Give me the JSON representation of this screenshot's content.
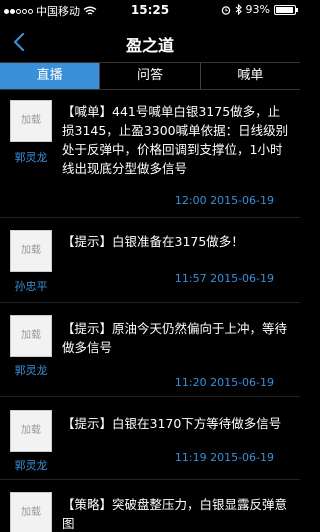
{
  "status_bar": {
    "carrier": "中国移动",
    "time": "15:25",
    "battery_percent": "93%",
    "battery_level": 0.93
  },
  "nav": {
    "title": "盈之道"
  },
  "tabs": [
    {
      "label": "直播",
      "active": true
    },
    {
      "label": "问答",
      "active": false
    },
    {
      "label": "喊单",
      "active": false
    }
  ],
  "messages": [
    {
      "avatar_label": "加载",
      "author": "郭灵龙",
      "text": "【喊单】441号喊单白银3175做多，止损3145，止盈3300喊单依据：日线级别处于反弹中，价格回调到支撑位，1小时线出现底分型做多信号",
      "time": "12:00 2015-06-19"
    },
    {
      "avatar_label": "加载",
      "author": "孙忠平",
      "text": "【提示】白银准备在3175做多！",
      "time": "11:57 2015-06-19"
    },
    {
      "avatar_label": "加载",
      "author": "郭灵龙",
      "text": "【提示】原油今天仍然偏向于上冲，等待做多信号",
      "time": "11:20 2015-06-19"
    },
    {
      "avatar_label": "加载",
      "author": "郭灵龙",
      "text": "【提示】白银在3170下方等待做多信号",
      "time": "11:19 2015-06-19"
    },
    {
      "avatar_label": "加载",
      "author": "",
      "text": "【策略】突破盘整压力，白银显露反弹意图",
      "time": ""
    }
  ]
}
